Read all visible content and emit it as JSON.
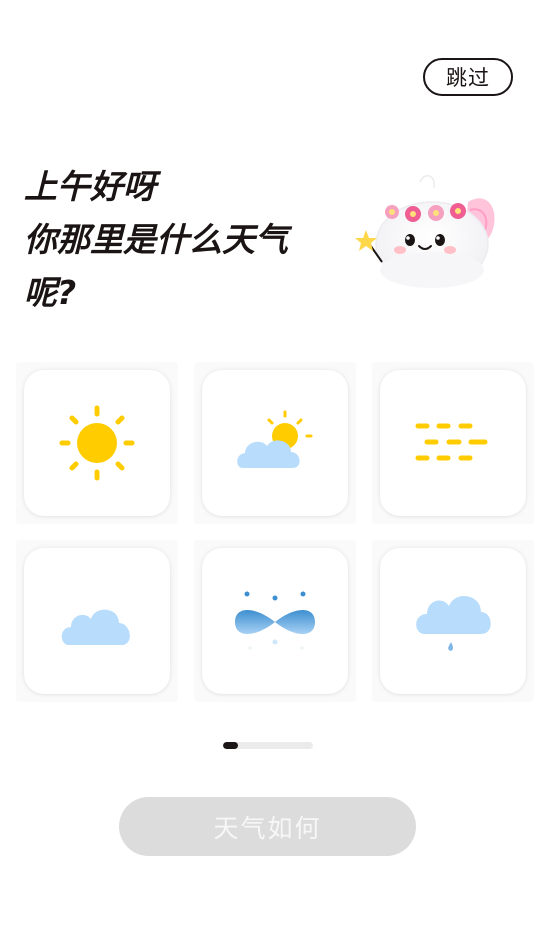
{
  "header": {
    "skip_label": "跳过"
  },
  "greeting": {
    "lines": [
      "上午好呀",
      "你那里是什么天气",
      "呢?"
    ]
  },
  "weather_options": [
    {
      "icon": "sunny-icon"
    },
    {
      "icon": "partly-cloudy-icon"
    },
    {
      "icon": "fog-icon"
    },
    {
      "icon": "cloudy-icon"
    },
    {
      "icon": "wind-icon"
    },
    {
      "icon": "rain-icon"
    }
  ],
  "progress": {
    "fraction": 0.17
  },
  "submit": {
    "label": "天气如何"
  },
  "colors": {
    "text": "#1b1414",
    "sun": "#ffcc00",
    "cloud": "#b8dcfb",
    "button_disabled": "#dcdcdc"
  }
}
